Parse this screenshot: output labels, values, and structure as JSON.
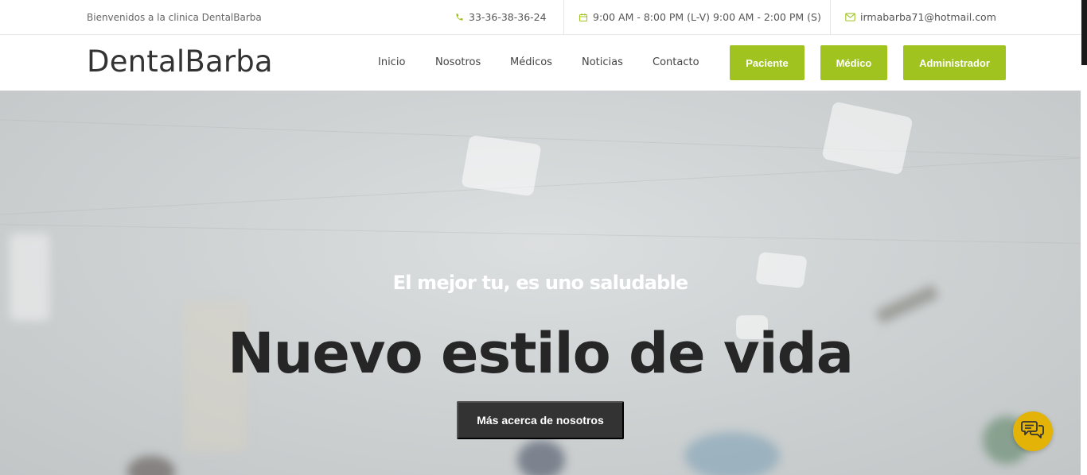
{
  "topbar": {
    "welcome": "Bienvenidos a la clinica DentalBarba",
    "phone": "33-36-38-36-24",
    "hours": "9:00 AM - 8:00 PM (L-V) 9:00 AM - 2:00 PM (S)",
    "email": "irmabarba71@hotmail.com"
  },
  "navbar": {
    "brand": "DentalBarba",
    "links": [
      "Inicio",
      "Nosotros",
      "Médicos",
      "Noticias",
      "Contacto"
    ],
    "buttons": [
      "Paciente",
      "Médico",
      "Administrador"
    ]
  },
  "hero": {
    "tagline": "El mejor tu, es uno saludable",
    "headline": "Nuevo estilo de vida",
    "cta": "Más acerca de nosotros"
  },
  "colors": {
    "accent": "#a0c31f",
    "chat": "#e3b307",
    "dark": "#333333"
  },
  "icons": {
    "phone": "phone-icon",
    "hours": "calendar-icon",
    "email": "mail-icon",
    "chat": "chat-icon"
  }
}
